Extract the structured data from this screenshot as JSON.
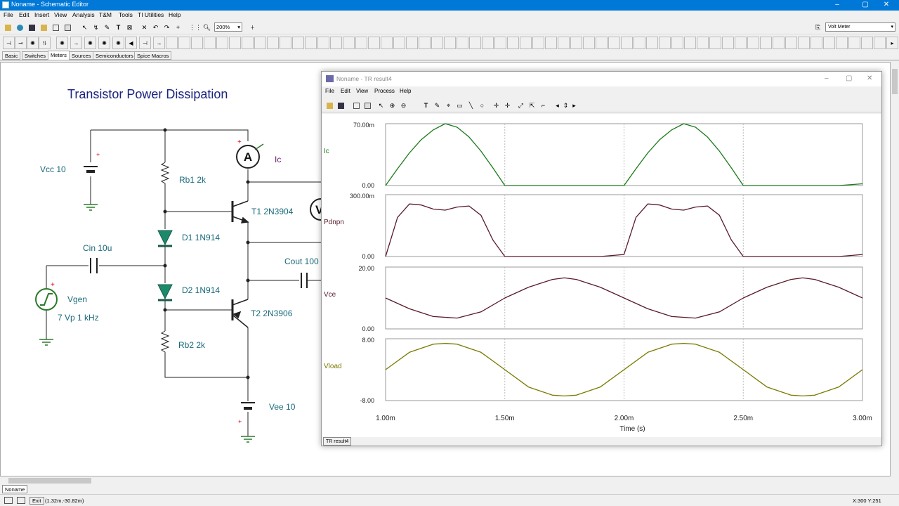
{
  "window": {
    "title": "Noname - Schematic Editor",
    "controls": {
      "minimize": "–",
      "maximize": "▢",
      "close": "✕"
    }
  },
  "menu": [
    "File",
    "Edit",
    "Insert",
    "View",
    "Analysis",
    "T&M",
    "Tools",
    "TI Utilities",
    "Help"
  ],
  "toolbar": {
    "zoom_value": "200%",
    "meter_select": "Volt Meter"
  },
  "component_tabs": [
    "Basic",
    "Switches",
    "Meters",
    "Sources",
    "Semiconductors",
    "Spice Macros"
  ],
  "active_component_tab": "Meters",
  "schematic": {
    "title": "Transistor Power Dissipation",
    "labels": {
      "vcc": "Vcc 10",
      "rb1": "Rb1 2k",
      "ic": "Ic",
      "t1": "T1 2N3904",
      "d1": "D1 1N914",
      "cin": "Cin 10u",
      "cout": "Cout 100",
      "d2": "D2 1N914",
      "vgen": "Vgen",
      "vgen_spec": "7 Vp 1 kHz",
      "t2": "T2 2N3906",
      "rb2": "Rb2 2k",
      "vee": "Vee 10",
      "ammeter": "A",
      "voltmeter": "V",
      "plus": "+"
    }
  },
  "document_tab": "Noname",
  "status": {
    "exit": "Exit",
    "coords": "(1.32m,-30.82m)",
    "cursor": "X:300  Y:251"
  },
  "result_window": {
    "title": "Noname - TR result4",
    "menu": [
      "File",
      "Edit",
      "View",
      "Process",
      "Help"
    ],
    "status_tab": "TR result4",
    "controls": {
      "minimize": "–",
      "maximize": "▢",
      "close": "✕"
    }
  },
  "chart_data": {
    "type": "line",
    "xlabel": "Time (s)",
    "x_ticks": [
      "1.00m",
      "1.50m",
      "2.00m",
      "2.50m",
      "3.00m"
    ],
    "xlim": [
      0.001,
      0.003
    ],
    "panels": [
      {
        "name": "Ic",
        "ylim_labels": [
          "70.00m",
          "0.00"
        ],
        "ylim": [
          0,
          0.07
        ],
        "color": "#1a7a1a",
        "x": [
          0.001,
          0.00105,
          0.0011,
          0.00115,
          0.0012,
          0.00125,
          0.0013,
          0.00135,
          0.0014,
          0.00145,
          0.0015,
          0.0016,
          0.0017,
          0.0018,
          0.0019,
          0.002,
          0.00205,
          0.0021,
          0.00215,
          0.0022,
          0.00225,
          0.0023,
          0.00235,
          0.0024,
          0.00245,
          0.0025,
          0.0026,
          0.0027,
          0.0028,
          0.0029,
          0.003
        ],
        "values": [
          0.0,
          0.019,
          0.037,
          0.052,
          0.063,
          0.07,
          0.066,
          0.055,
          0.039,
          0.02,
          0.0,
          0.0,
          0.0,
          0.0,
          0.0,
          0.0,
          0.019,
          0.037,
          0.052,
          0.063,
          0.07,
          0.066,
          0.055,
          0.039,
          0.02,
          0.0,
          0.0,
          0.0,
          0.0,
          0.0,
          0.002
        ]
      },
      {
        "name": "Pdnpn",
        "ylim_labels": [
          "300.00m",
          "0.00"
        ],
        "ylim": [
          0,
          0.3
        ],
        "color": "#5a1a2a",
        "x": [
          0.001,
          0.00105,
          0.0011,
          0.00115,
          0.0012,
          0.00125,
          0.0013,
          0.00135,
          0.0014,
          0.00145,
          0.0015,
          0.0016,
          0.0017,
          0.0018,
          0.0019,
          0.002,
          0.00205,
          0.0021,
          0.00215,
          0.0022,
          0.00225,
          0.0023,
          0.00235,
          0.0024,
          0.00245,
          0.0025,
          0.0026,
          0.0027,
          0.0028,
          0.0029,
          0.003
        ],
        "values": [
          0.0,
          0.19,
          0.255,
          0.25,
          0.23,
          0.225,
          0.24,
          0.245,
          0.2,
          0.08,
          0.0,
          0.0,
          0.0,
          0.0,
          0.0,
          0.01,
          0.19,
          0.255,
          0.25,
          0.23,
          0.225,
          0.24,
          0.245,
          0.2,
          0.08,
          0.0,
          0.0,
          0.0,
          0.0,
          0.0,
          0.01
        ]
      },
      {
        "name": "Vce",
        "ylim_labels": [
          "20.00",
          "0.00"
        ],
        "ylim": [
          0,
          20
        ],
        "color": "#5a1a2a",
        "x": [
          0.001,
          0.0011,
          0.0012,
          0.0013,
          0.0014,
          0.0015,
          0.0016,
          0.0017,
          0.00175,
          0.0018,
          0.0019,
          0.002,
          0.0021,
          0.0022,
          0.0023,
          0.0024,
          0.0025,
          0.0026,
          0.0027,
          0.00275,
          0.0028,
          0.0029,
          0.003
        ],
        "values": [
          10.0,
          6.5,
          4.0,
          3.5,
          5.5,
          10.0,
          13.5,
          16.0,
          16.5,
          16.0,
          13.5,
          10.0,
          6.5,
          4.0,
          3.5,
          5.5,
          10.0,
          13.5,
          16.0,
          16.5,
          16.0,
          13.5,
          10.0
        ]
      },
      {
        "name": "Vload",
        "ylim_labels": [
          "8.00",
          "-8.00"
        ],
        "ylim": [
          -8,
          8
        ],
        "color": "#7a7a00",
        "x": [
          0.001,
          0.0011,
          0.0012,
          0.00125,
          0.0013,
          0.0014,
          0.0015,
          0.0016,
          0.0017,
          0.00175,
          0.0018,
          0.0019,
          0.002,
          0.0021,
          0.0022,
          0.00225,
          0.0023,
          0.0024,
          0.0025,
          0.0026,
          0.0027,
          0.00275,
          0.0028,
          0.0029,
          0.003
        ],
        "values": [
          0.0,
          4.5,
          6.6,
          6.8,
          6.6,
          4.5,
          0.0,
          -4.5,
          -6.6,
          -6.8,
          -6.6,
          -4.5,
          0.0,
          4.5,
          6.6,
          6.8,
          6.6,
          4.5,
          0.0,
          -4.5,
          -6.6,
          -6.8,
          -6.6,
          -4.5,
          0.0
        ]
      }
    ]
  }
}
